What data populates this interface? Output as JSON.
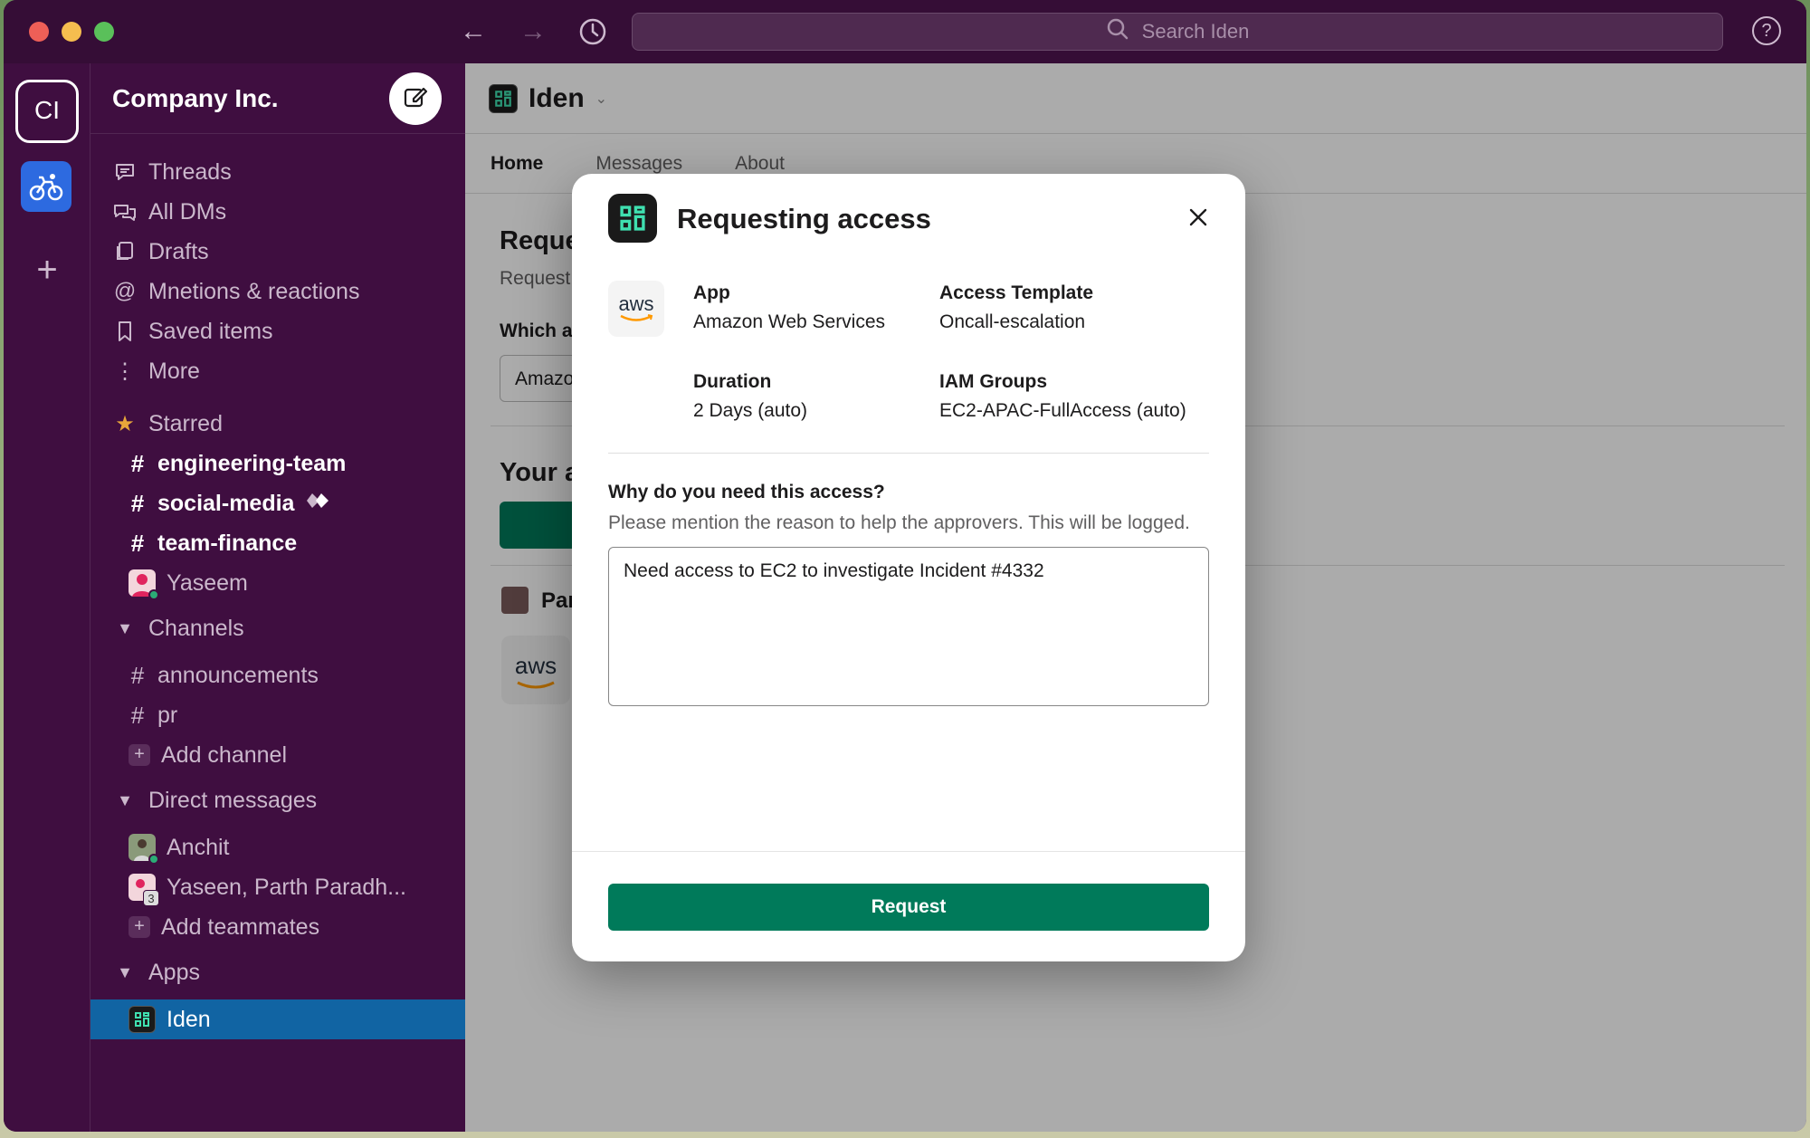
{
  "titlebar": {
    "search_placeholder": "Search Iden"
  },
  "rail": {
    "workspace_initials": "CI"
  },
  "sidebar": {
    "workspace_name": "Company Inc.",
    "nav": [
      {
        "label": "Threads",
        "icon": "threads-icon"
      },
      {
        "label": "All DMs",
        "icon": "dms-icon"
      },
      {
        "label": "Drafts",
        "icon": "drafts-icon"
      },
      {
        "label": "Mnetions & reactions",
        "icon": "at-icon"
      },
      {
        "label": "Saved items",
        "icon": "bookmark-icon"
      },
      {
        "label": "More",
        "icon": "more-vertical-icon"
      }
    ],
    "starred_label": "Starred",
    "starred": [
      {
        "label": "engineering-team"
      },
      {
        "label": "social-media"
      },
      {
        "label": "team-finance"
      },
      {
        "label": "Yaseem"
      }
    ],
    "channels_label": "Channels",
    "channels": [
      {
        "label": "announcements"
      },
      {
        "label": "pr"
      }
    ],
    "add_channel": "Add channel",
    "dms_label": "Direct messages",
    "dms": [
      {
        "label": "Anchit"
      },
      {
        "label": "Yaseen, Parth Paradh...",
        "badge": "3"
      }
    ],
    "add_teammates": "Add teammates",
    "apps_label": "Apps",
    "apps": [
      {
        "label": "Iden"
      }
    ]
  },
  "main": {
    "title": "Iden",
    "tabs": [
      "Home",
      "Messages",
      "About"
    ],
    "behind": {
      "heading": "Reque",
      "sub": "Request",
      "which": "Which a",
      "select_value": "Amazo",
      "your": "Your a",
      "person": "Par",
      "aws_text": "aws"
    }
  },
  "modal": {
    "title": "Requesting access",
    "app_logo_text": "aws",
    "fields": {
      "app_label": "App",
      "app_value": "Amazon Web Services",
      "template_label": "Access Template",
      "template_value": "Oncall-escalation",
      "duration_label": "Duration",
      "duration_value": "2 Days (auto)",
      "iam_label": "IAM Groups",
      "iam_value": "EC2-APAC-FullAccess (auto)"
    },
    "why_label": "Why do you need this access?",
    "why_help": "Please mention the reason to help the approvers. This will be logged.",
    "why_value": "Need access to EC2 to investigate Incident #4332",
    "request_button": "Request"
  },
  "colors": {
    "sidebar_bg": "#3f0e40",
    "active_item": "#1164a3",
    "primary_button": "#007a5a",
    "presence": "#2bac76"
  }
}
